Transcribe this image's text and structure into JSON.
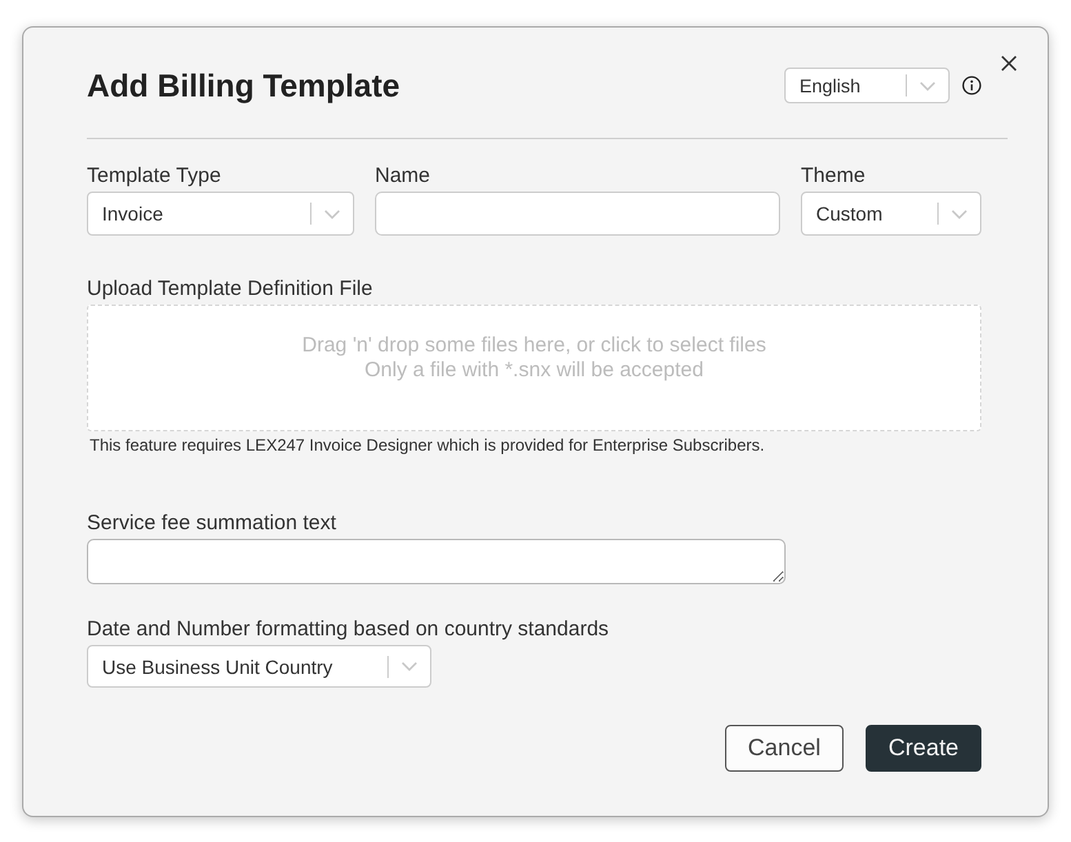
{
  "dialog": {
    "title": "Add Billing Template",
    "language_select": {
      "value": "English"
    },
    "fields": [
      {
        "kind": "select",
        "label": "Template Type",
        "value": "Invoice"
      },
      {
        "kind": "input",
        "label": "Name"
      },
      {
        "kind": "select",
        "label": "Theme",
        "value": "Custom"
      }
    ],
    "upload": {
      "label": "Upload Template Definition File",
      "prompt": "Drag 'n' drop some files here, or click to select files",
      "hint": "Only a file with *.snx will be accepted",
      "note": "This feature requires LEX247 Invoice Designer which is provided for Enterprise Subscribers."
    },
    "service_fee": {
      "label": "Service fee summation text"
    },
    "formatting": {
      "label": "Date and Number formatting based on country standards",
      "value": "Use Business Unit Country"
    },
    "buttons": [
      {
        "kind": "secondary",
        "label": "Cancel"
      },
      {
        "kind": "primary",
        "label": "Create"
      }
    ]
  }
}
